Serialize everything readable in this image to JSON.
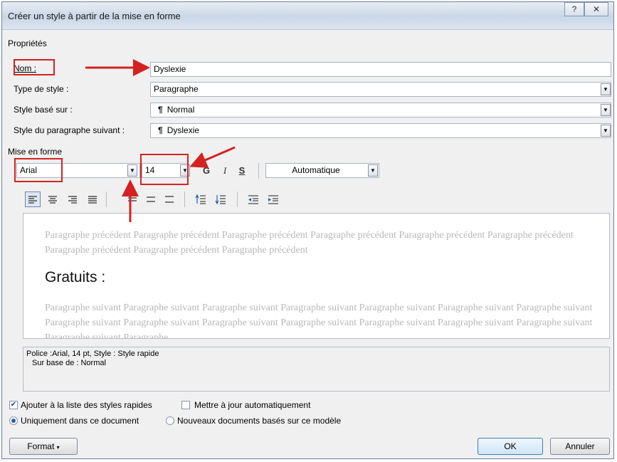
{
  "window": {
    "title": "Créer un style à partir de la mise en forme",
    "help_btn": "?",
    "close_btn": "✕"
  },
  "properties": {
    "group_label": "Propriétés",
    "name_label": "Nom :",
    "name_value": "Dyslexie",
    "type_label": "Type de style :",
    "type_value": "Paragraphe",
    "based_label": "Style basé sur :",
    "based_value": "Normal",
    "next_label": "Style du paragraphe suivant :",
    "next_value": "Dyslexie",
    "para_mark": "¶"
  },
  "formatting": {
    "group_label": "Mise en forme",
    "font": "Arial",
    "size": "14",
    "bold": "G",
    "italic": "I",
    "underline": "S",
    "color": "Automatique"
  },
  "preview": {
    "previous_text": "Paragraphe précédent Paragraphe précédent Paragraphe précédent Paragraphe précédent Paragraphe précédent Paragraphe précédent Paragraphe précédent Paragraphe précédent Paragraphe précédent",
    "current_text": "Gratuits :",
    "following_text": "Paragraphe suivant Paragraphe suivant Paragraphe suivant Paragraphe suivant Paragraphe suivant Paragraphe suivant Paragraphe suivant Paragraphe suivant Paragraphe suivant Paragraphe suivant Paragraphe suivant Paragraphe suivant Paragraphe suivant Paragraphe suivant Paragraphe suivant Paragraphe"
  },
  "description": {
    "line1": "Police :Arial, 14 pt, Style : Style rapide",
    "line2": "Sur base de : Normal"
  },
  "options": {
    "add_quick": "Ajouter à la liste des styles rapides",
    "add_quick_checked": true,
    "auto_update": "Mettre à jour automatiquement",
    "auto_update_checked": false,
    "only_doc": "Uniquement dans ce document",
    "new_docs": "Nouveaux documents basés sur ce modèle"
  },
  "buttons": {
    "format": "Format",
    "ok": "OK",
    "cancel": "Annuler"
  },
  "colors": {
    "annotation": "#d42222",
    "selected_radio": "#2a5fae"
  }
}
